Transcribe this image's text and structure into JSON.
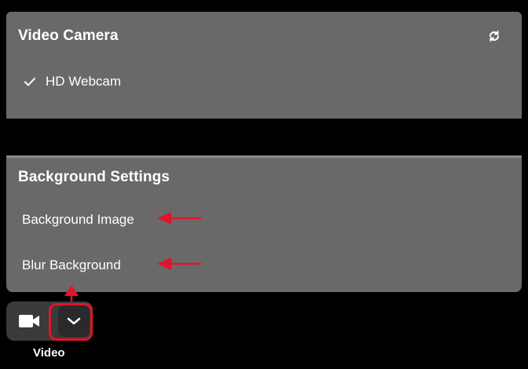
{
  "camera_panel": {
    "title": "Video Camera",
    "selected_camera": "HD Webcam"
  },
  "background_panel": {
    "title": "Background Settings",
    "options": [
      "Background Image",
      "Blur Background"
    ]
  },
  "toolbar": {
    "video_label": "Video"
  },
  "colors": {
    "panel_bg": "#696969",
    "annotation_red": "#e0142a",
    "page_bg": "#000000"
  },
  "icons": [
    "refresh-icon",
    "check-icon",
    "video-camera-icon",
    "chevron-down-icon"
  ]
}
